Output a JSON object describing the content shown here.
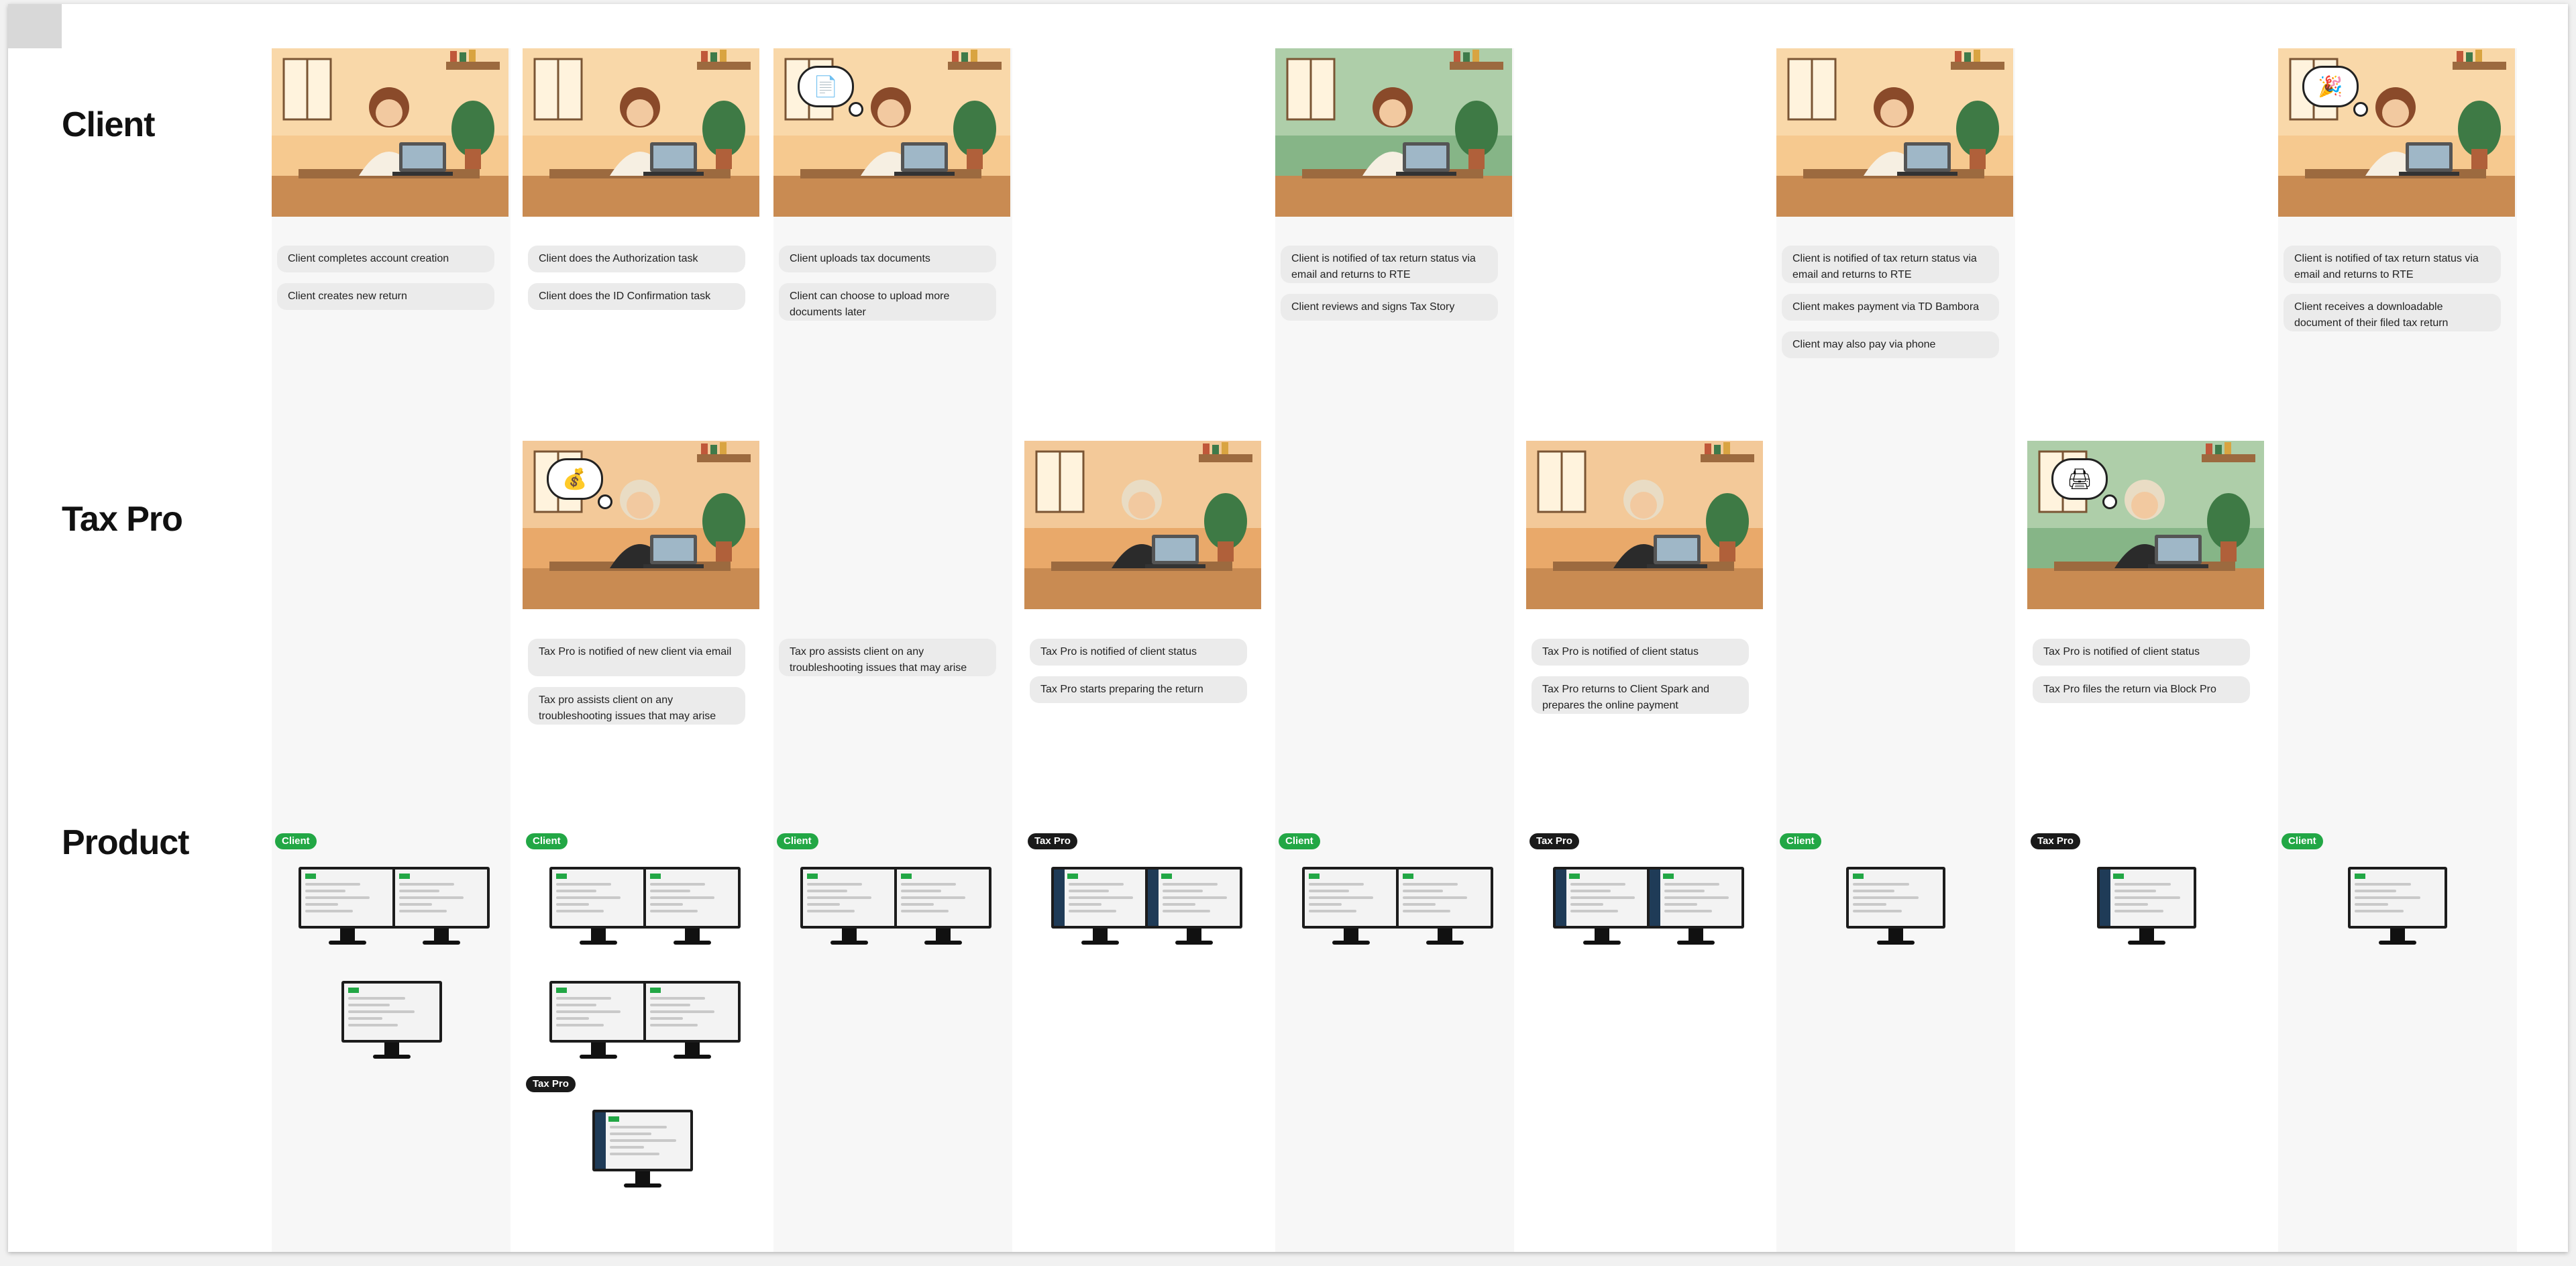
{
  "rows": {
    "client": "Client",
    "taxpro": "Tax Pro",
    "product": "Product"
  },
  "client_cards": [
    [
      "Client completes account creation",
      "Client creates new return"
    ],
    [
      "Client does the Authorization task",
      "Client does the ID Confirmation task"
    ],
    [
      "Client uploads tax documents",
      "Client can choose to upload more documents later"
    ],
    [],
    [
      "Client is notified of tax return status via email and returns to RTE",
      "Client reviews and signs Tax Story"
    ],
    [],
    [
      "Client is notified of tax return status via email and returns to RTE",
      "Client makes payment via TD Bambora",
      "Client may also pay via phone"
    ],
    [],
    [
      "Client is notified of tax return status via email and returns to RTE",
      "Client receives a downloadable document of their filed tax return"
    ]
  ],
  "taxpro_cards": [
    [],
    [
      "Tax Pro is notified of new client via email",
      "Tax pro assists client on any troubleshooting issues that may arise"
    ],
    [
      "Tax pro assists client on any troubleshooting issues that may arise"
    ],
    [
      "Tax Pro is notified of client status",
      "Tax Pro starts preparing the return"
    ],
    [],
    [
      "Tax Pro is notified of client status",
      "Tax Pro returns to Client Spark and prepares the online payment"
    ],
    [],
    [
      "Tax Pro is notified of client status",
      "Tax Pro files the return via Block Pro"
    ],
    []
  ],
  "product_badges": [
    "Client",
    "Client",
    "Client",
    "Tax Pro",
    "Client",
    "Tax Pro",
    "Client",
    "Tax Pro",
    "Client"
  ],
  "extra_badge": "Tax Pro",
  "bubble_icons": {
    "client_col3": "document-icon",
    "client_col9": "celebration-icon",
    "taxpro_col2": "money-bag-icon",
    "taxpro_col8": "printer-icon"
  },
  "colors": {
    "client_badge": "#22a745",
    "taxpro_badge": "#1a1a1a",
    "card_bg": "#ebebeb",
    "column_bg": "#f7f7f7",
    "warm_scene": "#f6c98f",
    "green_scene": "#86b587",
    "office_scene": "#e9a96a"
  }
}
